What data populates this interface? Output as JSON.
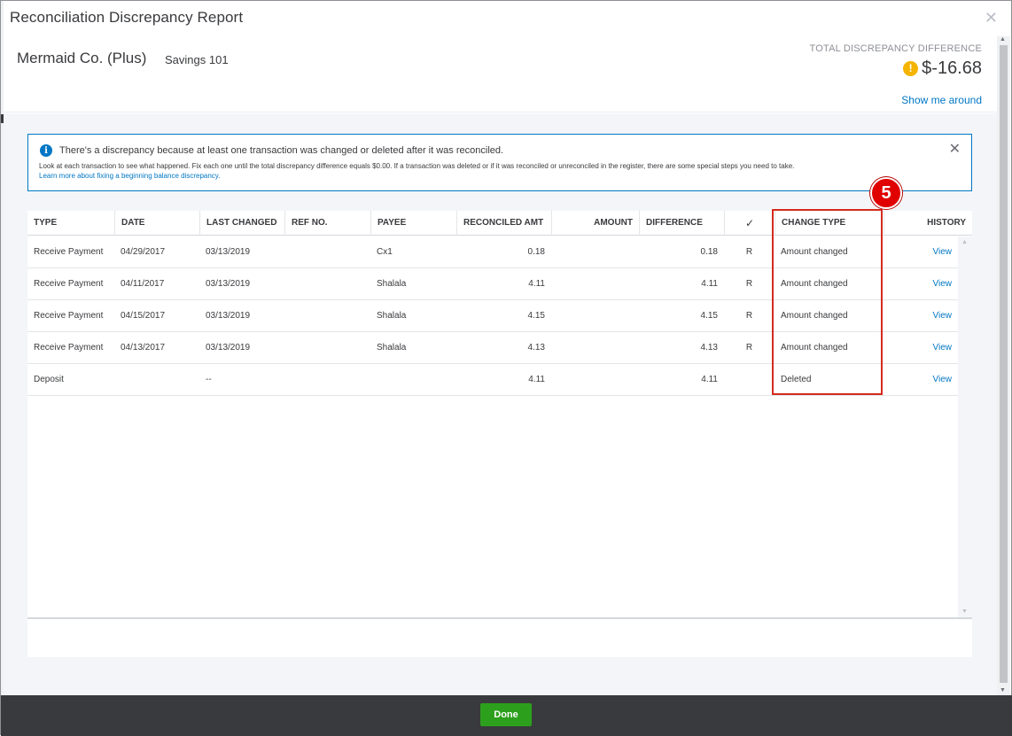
{
  "window": {
    "title": "Reconciliation Discrepancy Report",
    "close_icon": "close-icon"
  },
  "header": {
    "company": "Mermaid Co. (Plus)",
    "account": "Savings 101",
    "discrepancy_label": "TOTAL DISCREPANCY DIFFERENCE",
    "discrepancy_amount": "$-16.68",
    "warning_icon": "exclamation-circle-icon",
    "warning_glyph": "!",
    "show_me_around": "Show me around"
  },
  "info_banner": {
    "icon": "info-icon",
    "icon_glyph": "i",
    "title": "There's a discrepancy because at least one transaction was changed or deleted after it was reconciled.",
    "description": "Look at each transaction to see what happened. Fix each one until the total discrepancy difference equals $0.00. If a transaction was deleted or if it was reconciled or unreconciled in the register, there are some special steps you need to take.",
    "link": "Learn more about fixing a beginning balance discrepancy.",
    "close_glyph": "✕"
  },
  "table": {
    "columns": [
      "TYPE",
      "DATE",
      "LAST CHANGED",
      "REF NO.",
      "PAYEE",
      "RECONCILED AMT",
      "AMOUNT",
      "DIFFERENCE",
      "✓",
      "CHANGE TYPE",
      "HISTORY"
    ],
    "rows": [
      {
        "type": "Receive Payment",
        "date": "04/29/2017",
        "last_changed": "03/13/2019",
        "ref_no": "",
        "payee": "Cx1",
        "reconciled_amt": "0.18",
        "amount": "",
        "difference": "0.18",
        "status": "R",
        "change_type": "Amount changed",
        "history": "View"
      },
      {
        "type": "Receive Payment",
        "date": "04/11/2017",
        "last_changed": "03/13/2019",
        "ref_no": "",
        "payee": "Shalala",
        "reconciled_amt": "4.11",
        "amount": "",
        "difference": "4.11",
        "status": "R",
        "change_type": "Amount changed",
        "history": "View"
      },
      {
        "type": "Receive Payment",
        "date": "04/15/2017",
        "last_changed": "03/13/2019",
        "ref_no": "",
        "payee": "Shalala",
        "reconciled_amt": "4.15",
        "amount": "",
        "difference": "4.15",
        "status": "R",
        "change_type": "Amount changed",
        "history": "View"
      },
      {
        "type": "Receive Payment",
        "date": "04/13/2017",
        "last_changed": "03/13/2019",
        "ref_no": "",
        "payee": "Shalala",
        "reconciled_amt": "4.13",
        "amount": "",
        "difference": "4.13",
        "status": "R",
        "change_type": "Amount changed",
        "history": "View"
      },
      {
        "type": "Deposit",
        "date": "",
        "last_changed": "--",
        "ref_no": "",
        "payee": "",
        "reconciled_amt": "4.11",
        "amount": "",
        "difference": "4.11",
        "status": "",
        "change_type": "Deleted",
        "history": "View"
      }
    ]
  },
  "annotation": {
    "step_number": "5",
    "color": "#d52b1e"
  },
  "footer": {
    "done_label": "Done"
  },
  "colors": {
    "accent": "#0077c5",
    "primary_button": "#2ca01c",
    "footer_bar": "#393a3d",
    "warning": "#f4b400"
  }
}
